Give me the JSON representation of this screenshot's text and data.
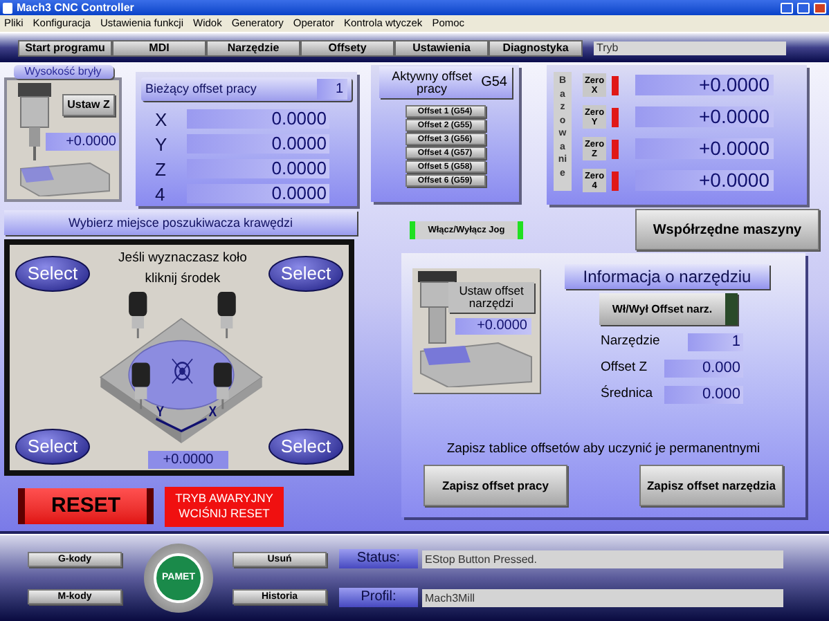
{
  "window": {
    "title": "Mach3 CNC Controller"
  },
  "menu": [
    "Pliki",
    "Konfiguracja",
    "Ustawienia funkcji",
    "Widok",
    "Generatory",
    "Operator",
    "Kontrola wtyczek",
    "Pomoc"
  ],
  "tabs": [
    {
      "label": "Start programu",
      "selected": false
    },
    {
      "label": "MDI",
      "selected": false
    },
    {
      "label": "Narzędzie",
      "selected": false
    },
    {
      "label": "Offsety",
      "selected": false
    },
    {
      "label": "Ustawienia",
      "selected": false
    },
    {
      "label": "Diagnostyka",
      "selected": false
    }
  ],
  "mode_field": {
    "value": "Tryb"
  },
  "part_height": {
    "title": "Wysokość bryły",
    "button": "Ustaw Z",
    "value": "+0.0000"
  },
  "work_offset": {
    "title": "Bieżący offset pracy",
    "number": "1",
    "axes": [
      {
        "axis": "X",
        "value": "0.0000"
      },
      {
        "axis": "Y",
        "value": "0.0000"
      },
      {
        "axis": "Z",
        "value": "0.0000"
      },
      {
        "axis": "4",
        "value": "0.0000"
      }
    ]
  },
  "active_offset": {
    "title": "Aktywny offset pracy",
    "code": "G54",
    "buttons": [
      "Offset 1 (G54)",
      "Offset 2 (G55)",
      "Offset 3 (G56)",
      "Offset 4 (G57)",
      "Offset 5 (G58)",
      "Offset 6 (G59)"
    ]
  },
  "homing": {
    "label": "Bazowanie",
    "axes": [
      {
        "button": "Zero X",
        "led_on": true,
        "value": "+0.0000"
      },
      {
        "button": "Zero Y",
        "led_on": true,
        "value": "+0.0000"
      },
      {
        "button": "Zero Z",
        "led_on": true,
        "value": "+0.0000"
      },
      {
        "button": "Zero 4",
        "led_on": true,
        "value": "+0.0000"
      }
    ]
  },
  "edge_finder": {
    "title": "Wybierz miejsce poszukiwacza krawędzi",
    "hint": [
      "Jeśli wyznaczasz koło",
      "kliknij środek"
    ],
    "select_buttons": [
      "Select",
      "Select",
      "Select",
      "Select"
    ],
    "axis_labels": [
      "Y",
      "X"
    ],
    "value": "+0.0000"
  },
  "reset": {
    "button": "RESET",
    "alarm": "TRYB AWARYJNY WCIŚNIJ RESET"
  },
  "jog_toggle": {
    "label": "Włącz/Wyłącz Jog",
    "on": true
  },
  "machine_coords_button": "Współrzędne maszyny",
  "tool_info": {
    "set_button": "Ustaw offset narzędzi",
    "set_value": "+0.0000",
    "title": "Informacja o narzędziu",
    "toggle": {
      "label": "Wł/Wył Offset narz.",
      "on": false
    },
    "fields": [
      {
        "label": "Narzędzie",
        "value": "1"
      },
      {
        "label": "Offset Z",
        "value": "0.000"
      },
      {
        "label": "Średnica",
        "value": "0.000"
      }
    ],
    "note": "Zapisz tablice offsetów aby uczynić je permanentnymi",
    "buttons": [
      "Zapisz offset pracy",
      "Zapisz offset narzędzia"
    ]
  },
  "bottom": {
    "left_buttons": [
      "G-kody",
      "M-kody"
    ],
    "logo": "PAMET",
    "mid_buttons": [
      "Usuń",
      "Historia"
    ],
    "status": {
      "label": "Status:",
      "value": "EStop Button Pressed."
    },
    "profile": {
      "label": "Profil:",
      "value": "Mach3Mill"
    }
  }
}
